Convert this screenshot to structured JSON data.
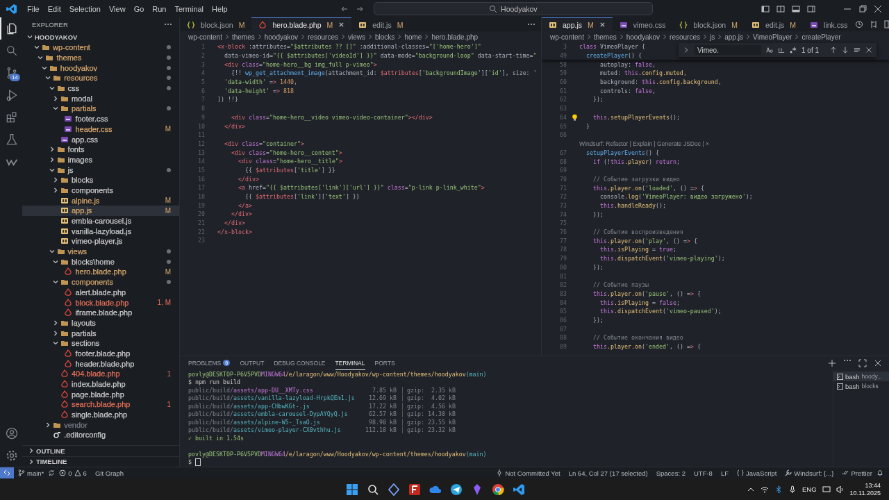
{
  "title_bar": {
    "menu": [
      "File",
      "Edit",
      "Selection",
      "View",
      "Go",
      "Run",
      "Terminal",
      "Help"
    ],
    "search": "Hoodyakov"
  },
  "activity_bar": {
    "items": [
      {
        "kind": "explorer",
        "selected": true
      },
      {
        "kind": "search",
        "selected": false
      },
      {
        "kind": "source-control",
        "selected": false,
        "badge": "14"
      },
      {
        "kind": "debug",
        "selected": false
      },
      {
        "kind": "extensions",
        "selected": false
      },
      {
        "kind": "testing",
        "selected": false
      },
      {
        "kind": "windsurf",
        "selected": false
      }
    ],
    "bottom": [
      {
        "kind": "account"
      },
      {
        "kind": "settings"
      }
    ]
  },
  "explorer": {
    "title": "EXPLORER",
    "root": "HOODYAKOV",
    "tree": [
      {
        "label": "wp-content",
        "kind": "folder",
        "expanded": true,
        "color": "#d7a86e",
        "dot": true,
        "selected": false,
        "children": [
          {
            "label": "themes",
            "kind": "folder",
            "expanded": true,
            "color": "#d7a86e",
            "dot": true,
            "selected": false,
            "children": [
              {
                "label": "hoodyakov",
                "kind": "folder",
                "expanded": true,
                "color": "#d7a86e",
                "dot": true,
                "selected": false,
                "children": [
                  {
                    "label": "resources",
                    "kind": "folder",
                    "expanded": true,
                    "color": "#d7a86e",
                    "dot": true,
                    "selected": false,
                    "children": [
                      {
                        "label": "css",
                        "kind": "folder",
                        "expanded": true,
                        "color": "#cccccc",
                        "dot": true,
                        "selected": false,
                        "children": [
                          {
                            "label": "modal",
                            "kind": "folder",
                            "expanded": false,
                            "color": "#cccccc",
                            "dot": false,
                            "selected": false
                          },
                          {
                            "label": "partials",
                            "kind": "folder",
                            "expanded": true,
                            "color": "#d7a86e",
                            "dot": true,
                            "selected": false,
                            "children": [
                              {
                                "label": "footer.css",
                                "kind": "css",
                                "color": "#cccccc",
                                "dot": false,
                                "selected": false
                              },
                              {
                                "label": "header.css",
                                "kind": "css",
                                "color": "#d7a86e",
                                "decoration": "M",
                                "dot": false,
                                "selected": false
                              }
                            ]
                          },
                          {
                            "label": "app.css",
                            "kind": "css",
                            "color": "#cccccc",
                            "dot": false,
                            "selected": false
                          }
                        ]
                      },
                      {
                        "label": "fonts",
                        "kind": "folder",
                        "expanded": false,
                        "color": "#cccccc",
                        "dot": false,
                        "selected": false
                      },
                      {
                        "label": "images",
                        "kind": "folder",
                        "expanded": false,
                        "color": "#cccccc",
                        "dot": false,
                        "selected": false
                      },
                      {
                        "label": "js",
                        "kind": "folder",
                        "expanded": true,
                        "color": "#cccccc",
                        "dot": true,
                        "selected": false,
                        "children": [
                          {
                            "label": "blocks",
                            "kind": "folder",
                            "expanded": false,
                            "color": "#cccccc",
                            "dot": false,
                            "selected": false
                          },
                          {
                            "label": "components",
                            "kind": "folder",
                            "expanded": false,
                            "color": "#cccccc",
                            "dot": false,
                            "selected": false
                          },
                          {
                            "label": "alpine.js",
                            "kind": "js",
                            "color": "#d7a86e",
                            "decoration": "M",
                            "dot": false,
                            "selected": false
                          },
                          {
                            "label": "app.js",
                            "kind": "js",
                            "color": "#d7a86e",
                            "decoration": "M",
                            "dot": false,
                            "selected": true
                          },
                          {
                            "label": "embla-carousel.js",
                            "kind": "js",
                            "color": "#cccccc",
                            "dot": false,
                            "selected": false
                          },
                          {
                            "label": "vanilla-lazyload.js",
                            "kind": "js",
                            "color": "#cccccc",
                            "dot": false,
                            "selected": false
                          },
                          {
                            "label": "vimeo-player.js",
                            "kind": "js",
                            "color": "#cccccc",
                            "dot": false,
                            "selected": false
                          }
                        ]
                      },
                      {
                        "label": "views",
                        "kind": "folder",
                        "expanded": true,
                        "color": "#d7a86e",
                        "dot": true,
                        "selected": false,
                        "children": [
                          {
                            "label": "blocks\\home",
                            "kind": "folder",
                            "expanded": true,
                            "color": "#cccccc",
                            "dot": true,
                            "selected": false,
                            "children": [
                              {
                                "label": "hero.blade.php",
                                "kind": "blade",
                                "color": "#d7a86e",
                                "decoration": "M",
                                "dot": false,
                                "selected": false
                              }
                            ]
                          },
                          {
                            "label": "components",
                            "kind": "folder",
                            "expanded": true,
                            "color": "#d7a86e",
                            "dot": true,
                            "selected": false,
                            "children": [
                              {
                                "label": "alert.blade.php",
                                "kind": "blade",
                                "color": "#cccccc",
                                "dot": false,
                                "selected": false
                              },
                              {
                                "label": "block.blade.php",
                                "kind": "blade",
                                "color": "#e8705a",
                                "decoration": "1, M",
                                "dot": false,
                                "selected": false
                              },
                              {
                                "label": "iframe.blade.php",
                                "kind": "blade",
                                "color": "#cccccc",
                                "dot": false,
                                "selected": false
                              }
                            ]
                          },
                          {
                            "label": "layouts",
                            "kind": "folder",
                            "expanded": false,
                            "color": "#cccccc",
                            "dot": false,
                            "selected": false
                          },
                          {
                            "label": "partials",
                            "kind": "folder",
                            "expanded": false,
                            "color": "#cccccc",
                            "dot": false,
                            "selected": false
                          },
                          {
                            "label": "sections",
                            "kind": "folder",
                            "expanded": true,
                            "color": "#cccccc",
                            "dot": false,
                            "selected": false,
                            "children": [
                              {
                                "label": "footer.blade.php",
                                "kind": "blade",
                                "color": "#cccccc",
                                "dot": false,
                                "selected": false
                              },
                              {
                                "label": "header.blade.php",
                                "kind": "blade",
                                "color": "#cccccc",
                                "dot": false,
                                "selected": false
                              }
                            ]
                          },
                          {
                            "label": "404.blade.php",
                            "kind": "blade",
                            "color": "#e8705a",
                            "decoration": "1",
                            "dot": false,
                            "selected": false
                          },
                          {
                            "label": "index.blade.php",
                            "kind": "blade",
                            "color": "#cccccc",
                            "dot": false,
                            "selected": false
                          },
                          {
                            "label": "page.blade.php",
                            "kind": "blade",
                            "color": "#cccccc",
                            "dot": false,
                            "selected": false
                          },
                          {
                            "label": "search.blade.php",
                            "kind": "blade",
                            "color": "#e8705a",
                            "decoration": "1",
                            "dot": false,
                            "selected": false
                          },
                          {
                            "label": "single.blade.php",
                            "kind": "blade",
                            "color": "#cccccc",
                            "dot": false,
                            "selected": false
                          }
                        ]
                      }
                    ]
                  },
                  {
                    "label": "vendor",
                    "kind": "folder",
                    "expanded": false,
                    "color": "#7a7f87",
                    "dot": false,
                    "selected": false
                  },
                  {
                    "label": ".editorconfig",
                    "kind": "config",
                    "color": "#cccccc",
                    "dot": false,
                    "selected": false
                  }
                ]
              }
            ]
          }
        ]
      }
    ],
    "sections": [
      "OUTLINE",
      "TIMELINE"
    ]
  },
  "left_editor": {
    "tabs": [
      {
        "label": "block.json",
        "kind": "json",
        "decoration": "M",
        "selected": false
      },
      {
        "label": "hero.blade.php",
        "kind": "blade",
        "decoration": "M",
        "selected": true
      },
      {
        "label": "edit.js",
        "kind": "js",
        "decoration": "M",
        "selected": false
      }
    ],
    "breadcrumbs": [
      "wp-content",
      "themes",
      "hoodyakov",
      "resources",
      "views",
      "blocks",
      "home",
      "hero.blade.php"
    ],
    "lines": [
      {
        "n": "1",
        "text": "<x-block :attributes=\"$attributes ?? []\" :additional-classes=\"['home-hero']\""
      },
      {
        "n": "2",
        "text": "  data-vimeo-id=\"{{ $attributes['videoId'] }}\" data-mode=\"background-loop\" data-start-time=\""
      },
      {
        "n": "3",
        "text": "  <div class=\"home-hero__bg img_full p-vimeo\">"
      },
      {
        "n": "4",
        "text": "    {!! wp_get_attachment_image(attachment_id: $attributes['backgroundImage']['id'], size: '"
      },
      {
        "n": "5",
        "text": "  'data-width' => 1440,"
      },
      {
        "n": "6",
        "text": "  'data-height' => 818"
      },
      {
        "n": "7",
        "text": "]) !!}"
      },
      {
        "n": "8"
      },
      {
        "n": "9",
        "text": "    <div class=\"home-hero__video vimeo-video-container\"></div>"
      },
      {
        "n": "10",
        "text": "  </div>"
      },
      {
        "n": "11"
      },
      {
        "n": "12",
        "text": "  <div class=\"container\">"
      },
      {
        "n": "13",
        "text": "    <div class=\"home-hero__content\">"
      },
      {
        "n": "14",
        "text": "      <div class=\"home-hero__title\">"
      },
      {
        "n": "15",
        "text": "        {{ $attributes['title'] }}"
      },
      {
        "n": "16",
        "text": "      </div>"
      },
      {
        "n": "17",
        "text": "      <a href=\"{{ $attributes['link']['url'] }}\" class=\"p-link p-link_white\">"
      },
      {
        "n": "18",
        "text": "        {{ $attributes['link']['text'] }}"
      },
      {
        "n": "19",
        "text": "      </a>"
      },
      {
        "n": "20",
        "text": "    </div>"
      },
      {
        "n": "21",
        "text": "  </div>"
      },
      {
        "n": "22",
        "text": "</x-block>"
      },
      {
        "n": "23"
      }
    ]
  },
  "right_editor": {
    "tabs": [
      {
        "label": "app.js",
        "kind": "js",
        "decoration": "M",
        "selected": true
      },
      {
        "label": "vimeo.css",
        "kind": "css",
        "selected": false
      },
      {
        "label": "block.json",
        "kind": "json",
        "decoration": "M",
        "selected": false
      },
      {
        "label": "edit.js",
        "kind": "js",
        "decoration": "M",
        "selected": false
      },
      {
        "label": "link.css",
        "kind": "css",
        "selected": false
      }
    ],
    "breadcrumbs": [
      "wp-content",
      "themes",
      "hoodyakov",
      "resources",
      "js",
      "app.js",
      "VimeoPlayer",
      "createPlayer"
    ],
    "sticky": [
      {
        "n": "3",
        "text": "class VimeoPlayer {"
      },
      {
        "n": "49",
        "text": "  createPlayer() {"
      }
    ],
    "find": {
      "value": "Vimeo.",
      "result": "1 of 1"
    },
    "lines": [
      {
        "n": "58",
        "text": "      autoplay: false,"
      },
      {
        "n": "59",
        "text": "      muted: this.config.muted,"
      },
      {
        "n": "60",
        "text": "      background: this.config.background,"
      },
      {
        "n": "61",
        "text": "      controls: false,"
      },
      {
        "n": "62",
        "text": "    });"
      },
      {
        "n": "63"
      },
      {
        "n": "64",
        "text": "    this.setupPlayerEvents();",
        "bulb": true
      },
      {
        "n": "65",
        "text": "  }"
      },
      {
        "n": "66"
      },
      {
        "codelens": "Windsurf: Refactor | Explain | Generate JSDoc | ×"
      },
      {
        "n": "67",
        "text": "  setupPlayerEvents() {"
      },
      {
        "n": "68",
        "text": "    if (!this.player) return;"
      },
      {
        "n": "69"
      },
      {
        "n": "70",
        "text": "    // Событие загрузки видео"
      },
      {
        "n": "71",
        "text": "    this.player.on('loaded', () => {"
      },
      {
        "n": "72",
        "text": "      console.log('VimeoPlayer: видео загружено');"
      },
      {
        "n": "73",
        "text": "      this.handleReady();"
      },
      {
        "n": "74",
        "text": "    });"
      },
      {
        "n": "75"
      },
      {
        "n": "76",
        "text": "    // Событие воспроизведения"
      },
      {
        "n": "77",
        "text": "    this.player.on('play', () => {"
      },
      {
        "n": "78",
        "text": "      this.isPlaying = true;"
      },
      {
        "n": "79",
        "text": "      this.dispatchEvent('vimeo-playing');"
      },
      {
        "n": "80",
        "text": "    });"
      },
      {
        "n": "81"
      },
      {
        "n": "82",
        "text": "    // Событие паузы"
      },
      {
        "n": "83",
        "text": "    this.player.on('pause', () => {"
      },
      {
        "n": "84",
        "text": "      this.isPlaying = false;"
      },
      {
        "n": "85",
        "text": "      this.dispatchEvent('vimeo-paused');"
      },
      {
        "n": "86",
        "text": "    });"
      },
      {
        "n": "87"
      },
      {
        "n": "88",
        "text": "    // Событие окончания видео"
      },
      {
        "n": "89",
        "text": "    this.player.on('ended', () => {"
      }
    ]
  },
  "panel": {
    "tabs": [
      {
        "label": "PROBLEMS",
        "badge": "6",
        "selected": false
      },
      {
        "label": "OUTPUT",
        "selected": false
      },
      {
        "label": "DEBUG CONSOLE",
        "selected": false
      },
      {
        "label": "TERMINAL",
        "selected": true
      },
      {
        "label": "PORTS",
        "selected": false
      }
    ],
    "terminal": [
      {
        "kind": "prompt",
        "user": "povly@DESKTOP-P6V5PVD",
        "shell": "MINGW64",
        "path": "/e/laragon/www/Hoodyakov/wp-content/themes/hoodyakov",
        "branch": "(main)"
      },
      {
        "kind": "command",
        "text": "$ npm run build"
      },
      {
        "kind": "asset",
        "prefix": "public/build/",
        "file": "assets/app-DU__XMTy.css",
        "stylesheet": true,
        "size": "7.85 kB",
        "gzip": "gzip:  2.35 kB"
      },
      {
        "kind": "asset",
        "prefix": "public/build/",
        "file": "assets/vanilla-lazyload-HrpkQEm1.js",
        "stylesheet": false,
        "size": "12.69 kB",
        "gzip": "gzip:  4.02 kB"
      },
      {
        "kind": "asset",
        "prefix": "public/build/",
        "file": "assets/app-CHbwKGt-.js",
        "stylesheet": false,
        "size": "17.22 kB",
        "gzip": "gzip:  4.56 kB"
      },
      {
        "kind": "asset",
        "prefix": "public/build/",
        "file": "assets/embla-carousel-DypAYQyQ.js",
        "stylesheet": false,
        "size": "62.57 kB",
        "gzip": "gzip: 14.30 kB"
      },
      {
        "kind": "asset",
        "prefix": "public/build/",
        "file": "assets/alpine-W5-_TsaO.js",
        "stylesheet": false,
        "size": "98.90 kB",
        "gzip": "gzip: 23.55 kB"
      },
      {
        "kind": "asset",
        "prefix": "public/build/",
        "file": "assets/vimeo-player-CX0vthhu.js",
        "stylesheet": false,
        "size": "112.18 kB",
        "gzip": "gzip: 23.32 kB"
      },
      {
        "kind": "success",
        "text": "✓ built in 1.54s"
      },
      {
        "kind": "blank"
      },
      {
        "kind": "prompt",
        "user": "povly@DESKTOP-P6V5PVD",
        "shell": "MINGW64",
        "path": "/e/laragon/www/Hoodyakov/wp-content/themes/hoodyakov",
        "branch": "(main)"
      },
      {
        "kind": "input",
        "text": "$"
      }
    ],
    "terminals": [
      {
        "name": "bash",
        "folder": "hoody...",
        "selected": true
      },
      {
        "name": "bash",
        "folder": "blocks",
        "selected": false
      }
    ]
  },
  "status_bar": {
    "branch": "main*",
    "errors": "0",
    "warnings": "6",
    "git_graph": "Git Graph",
    "right": [
      {
        "kind": "blame",
        "text": "Not Committed Yet"
      },
      {
        "kind": "text",
        "text": "Ln 64, Col 27 (17 selected)"
      },
      {
        "kind": "text",
        "text": "Spaces: 2"
      },
      {
        "kind": "text",
        "text": "UTF-8"
      },
      {
        "kind": "text",
        "text": "LF"
      },
      {
        "kind": "language",
        "text": "JavaScript"
      },
      {
        "kind": "windsurf",
        "text": "Windsurf: {...}"
      },
      {
        "kind": "prettier",
        "text": "Prettier"
      }
    ]
  },
  "taskbar": {
    "language": "ENG",
    "time": "13:44",
    "date": "10.11.2025"
  }
}
